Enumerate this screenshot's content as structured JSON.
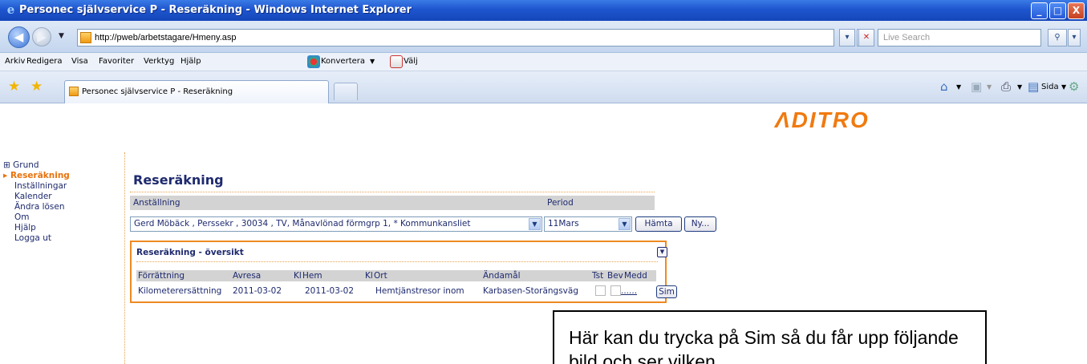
{
  "window": {
    "title": "Personec självservice P - Reseräkning - Windows Internet Explorer",
    "buttons": {
      "minimize": "_",
      "maximize": "□",
      "close": "X"
    }
  },
  "address_bar": {
    "url": "http://pweb/arbetstagare/Hmeny.asp",
    "search_placeholder": "Live Search"
  },
  "menu": {
    "items": [
      "Arkiv",
      "Redigera",
      "Visa",
      "Favoriter",
      "Verktyg",
      "Hjälp"
    ],
    "convert_label": "Konvertera",
    "select_label": "Välj"
  },
  "tabs": {
    "active_tab": "Personec självservice P - Reseräkning"
  },
  "command_bar": {
    "page_label": "Sida",
    "tools_label": "Verktyg"
  },
  "page": {
    "logo": "ΛDITRO",
    "sidebar": {
      "grund": "Grund",
      "active": "Reseräkning",
      "items": [
        "Inställningar",
        "Kalender",
        "Ändra lösen",
        "Om",
        "Hjälp",
        "Logga ut"
      ]
    },
    "title": "Reseräkning",
    "form": {
      "employment_label": "Anställning",
      "period_label": "Period",
      "employment_value": "Gerd Möbäck , Perssekr , 30034 , TV, Månavlönad förmgrp 1, * Kommunkansliet",
      "period_value": "11Mars",
      "fetch_button": "Hämta",
      "new_button": "Ny..."
    },
    "overview": {
      "title": "Reseräkning - översikt",
      "columns": [
        "Förrättning",
        "Avresa",
        "Kl",
        "Hem",
        "Kl",
        "Ort",
        "Ändamål",
        "Tst",
        "Bev",
        "Medd"
      ],
      "rows": [
        {
          "forrattning": "Kilometerersättning",
          "avresa": "2011-03-02",
          "hem": "2011-03-02",
          "ort": "Hemtjänstresor inom",
          "andamal": "Karbasen-Storängsväg",
          "medd": "......",
          "sim_button": "Sim"
        }
      ]
    }
  },
  "callout": {
    "text": "Här kan du trycka på Sim så du får upp följande bild och ser vilken"
  }
}
